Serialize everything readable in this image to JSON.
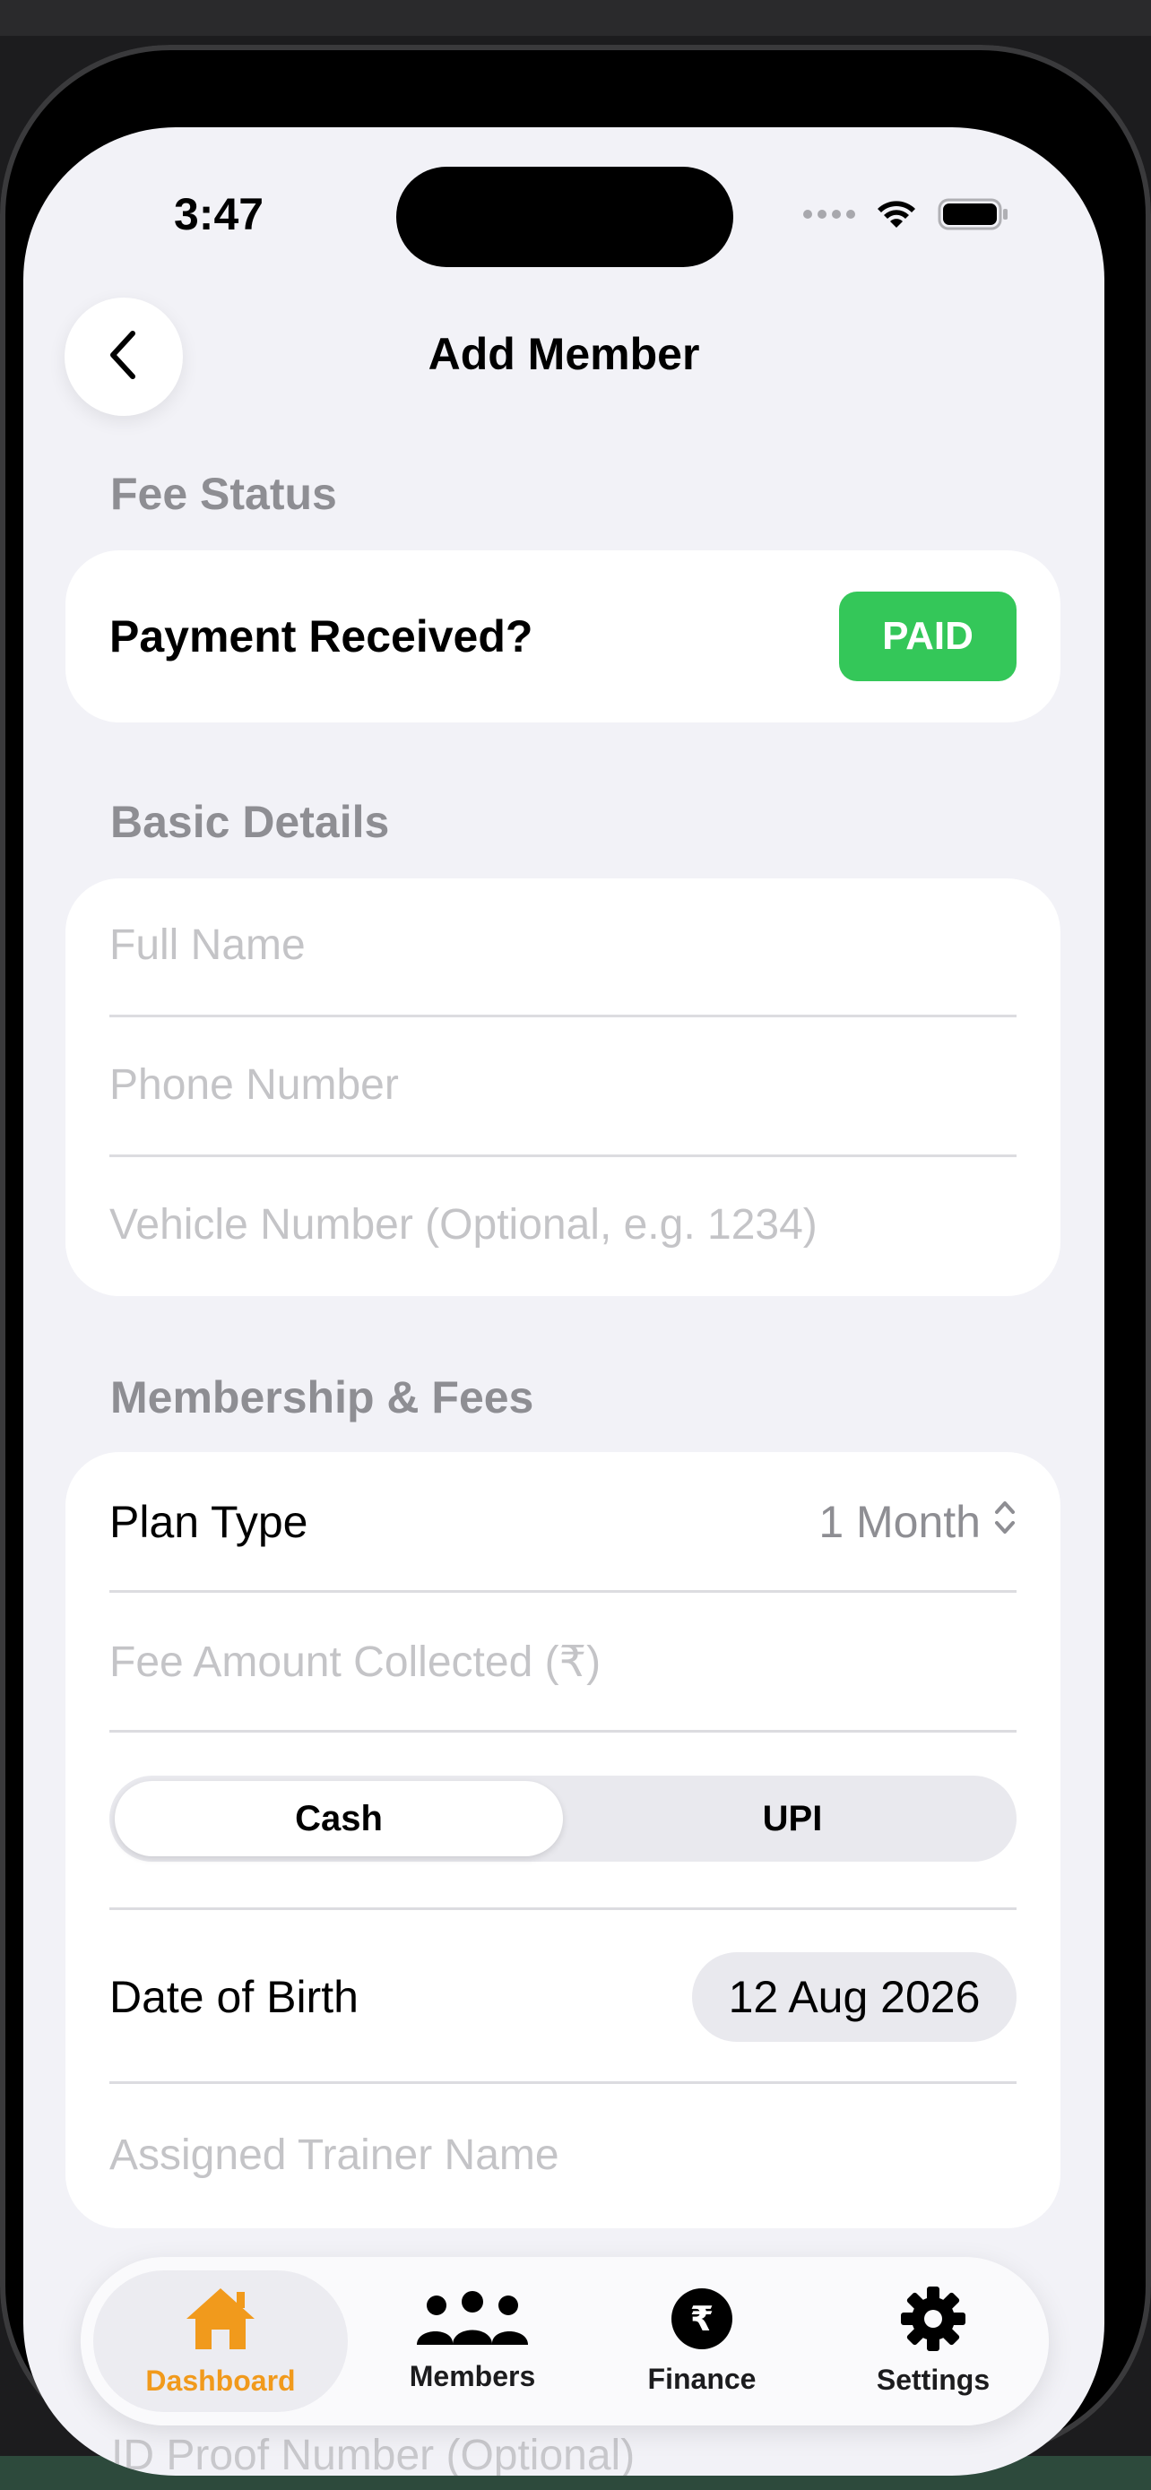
{
  "status_bar": {
    "time": "3:47"
  },
  "nav": {
    "title": "Add Member"
  },
  "fee_status": {
    "header": "Fee Status",
    "label": "Payment Received?",
    "badge": "PAID",
    "badge_color": "#34c759"
  },
  "basic_details": {
    "header": "Basic Details",
    "full_name_placeholder": "Full Name",
    "phone_placeholder": "Phone Number",
    "vehicle_placeholder": "Vehicle Number (Optional, e.g. 1234)"
  },
  "membership": {
    "header": "Membership & Fees",
    "plan_label": "Plan Type",
    "plan_value": "1 Month",
    "fee_placeholder": "Fee Amount Collected (₹)",
    "payment_modes": [
      "Cash",
      "UPI"
    ],
    "selected_mode": "Cash",
    "dob_label": "Date of Birth",
    "dob_value": "12 Aug 2026",
    "trainer_placeholder": "Assigned Trainer Name"
  },
  "behind_tabbar": {
    "id_proof_placeholder": "ID Proof Number (Optional)"
  },
  "tabbar": {
    "accent": "#f19a1c",
    "items": [
      {
        "label": "Dashboard",
        "icon": "house-icon",
        "active": true
      },
      {
        "label": "Members",
        "icon": "people-icon",
        "active": false
      },
      {
        "label": "Finance",
        "icon": "rupee-circle-icon",
        "active": false
      },
      {
        "label": "Settings",
        "icon": "gear-icon",
        "active": false
      }
    ]
  }
}
